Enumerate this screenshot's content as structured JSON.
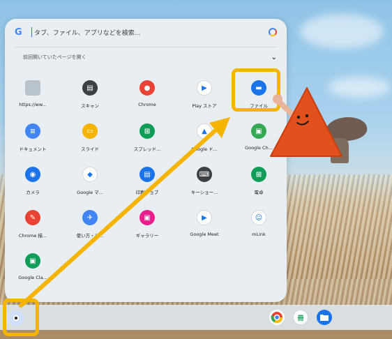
{
  "search": {
    "logo": "G",
    "placeholder": "タブ、ファイル、アプリなどを検索..."
  },
  "continue_section": {
    "label": "前回開いていたページを開く"
  },
  "apps": [
    {
      "label": "https://ww...",
      "icon": "webpage-icon",
      "color": "#b9c3cc",
      "glyph": ""
    },
    {
      "label": "スキャン",
      "icon": "scanner-icon",
      "color": "#3c4043",
      "glyph": "▤"
    },
    {
      "label": "Chrome",
      "icon": "chrome-icon",
      "color": "#ea4335",
      "glyph": "●"
    },
    {
      "label": "Play ストア",
      "icon": "play-store-icon",
      "color": "#ffffff",
      "glyph": "▶"
    },
    {
      "label": "ファイル",
      "icon": "files-icon",
      "color": "#1a73e8",
      "glyph": "▬"
    },
    {
      "label": "ドキュメント",
      "icon": "docs-icon",
      "color": "#4285f4",
      "glyph": "≡"
    },
    {
      "label": "スライド",
      "icon": "slides-icon",
      "color": "#f4b400",
      "glyph": "▭"
    },
    {
      "label": "スプレッド...",
      "icon": "sheets-icon",
      "color": "#0f9d58",
      "glyph": "⊞"
    },
    {
      "label": "Google ド...",
      "icon": "drive-icon",
      "color": "#ffffff",
      "glyph": "▲"
    },
    {
      "label": "Google Ch...",
      "icon": "chat-icon",
      "color": "#34a853",
      "glyph": "▣"
    },
    {
      "label": "カメラ",
      "icon": "camera-icon",
      "color": "#1a73e8",
      "glyph": "◉"
    },
    {
      "label": "Google マ...",
      "icon": "maps-icon",
      "color": "#ffffff",
      "glyph": "◆"
    },
    {
      "label": "印刷ジョブ",
      "icon": "print-jobs-icon",
      "color": "#1a73e8",
      "glyph": "▤"
    },
    {
      "label": "キーショー...",
      "icon": "shortcuts-icon",
      "color": "#3c4043",
      "glyph": "⌨"
    },
    {
      "label": "電卓",
      "icon": "calculator-icon",
      "color": "#0f9d58",
      "glyph": "⊞"
    },
    {
      "label": "Chrome 描...",
      "icon": "canvas-icon",
      "color": "#ea4335",
      "glyph": "✎"
    },
    {
      "label": "使い方・ヒ...",
      "icon": "explore-icon",
      "color": "#4285f4",
      "glyph": "✈"
    },
    {
      "label": "ギャラリー",
      "icon": "gallery-icon",
      "color": "#e91e8c",
      "glyph": "▣"
    },
    {
      "label": "Google Meet",
      "icon": "meet-icon",
      "color": "#ffffff",
      "glyph": "▶"
    },
    {
      "label": "mLink",
      "icon": "mlink-icon",
      "color": "#ffffff",
      "glyph": "☺"
    },
    {
      "label": "Google Cla...",
      "icon": "classroom-icon",
      "color": "#0f9d58",
      "glyph": "▣"
    }
  ],
  "shelf": {
    "apps": [
      {
        "icon": "chrome-icon"
      },
      {
        "icon": "mlink-icon"
      },
      {
        "icon": "files-icon"
      }
    ]
  },
  "colors": {
    "highlight": "#f5b400",
    "arrow": "#f5b400",
    "mascot": "#e2501d"
  }
}
